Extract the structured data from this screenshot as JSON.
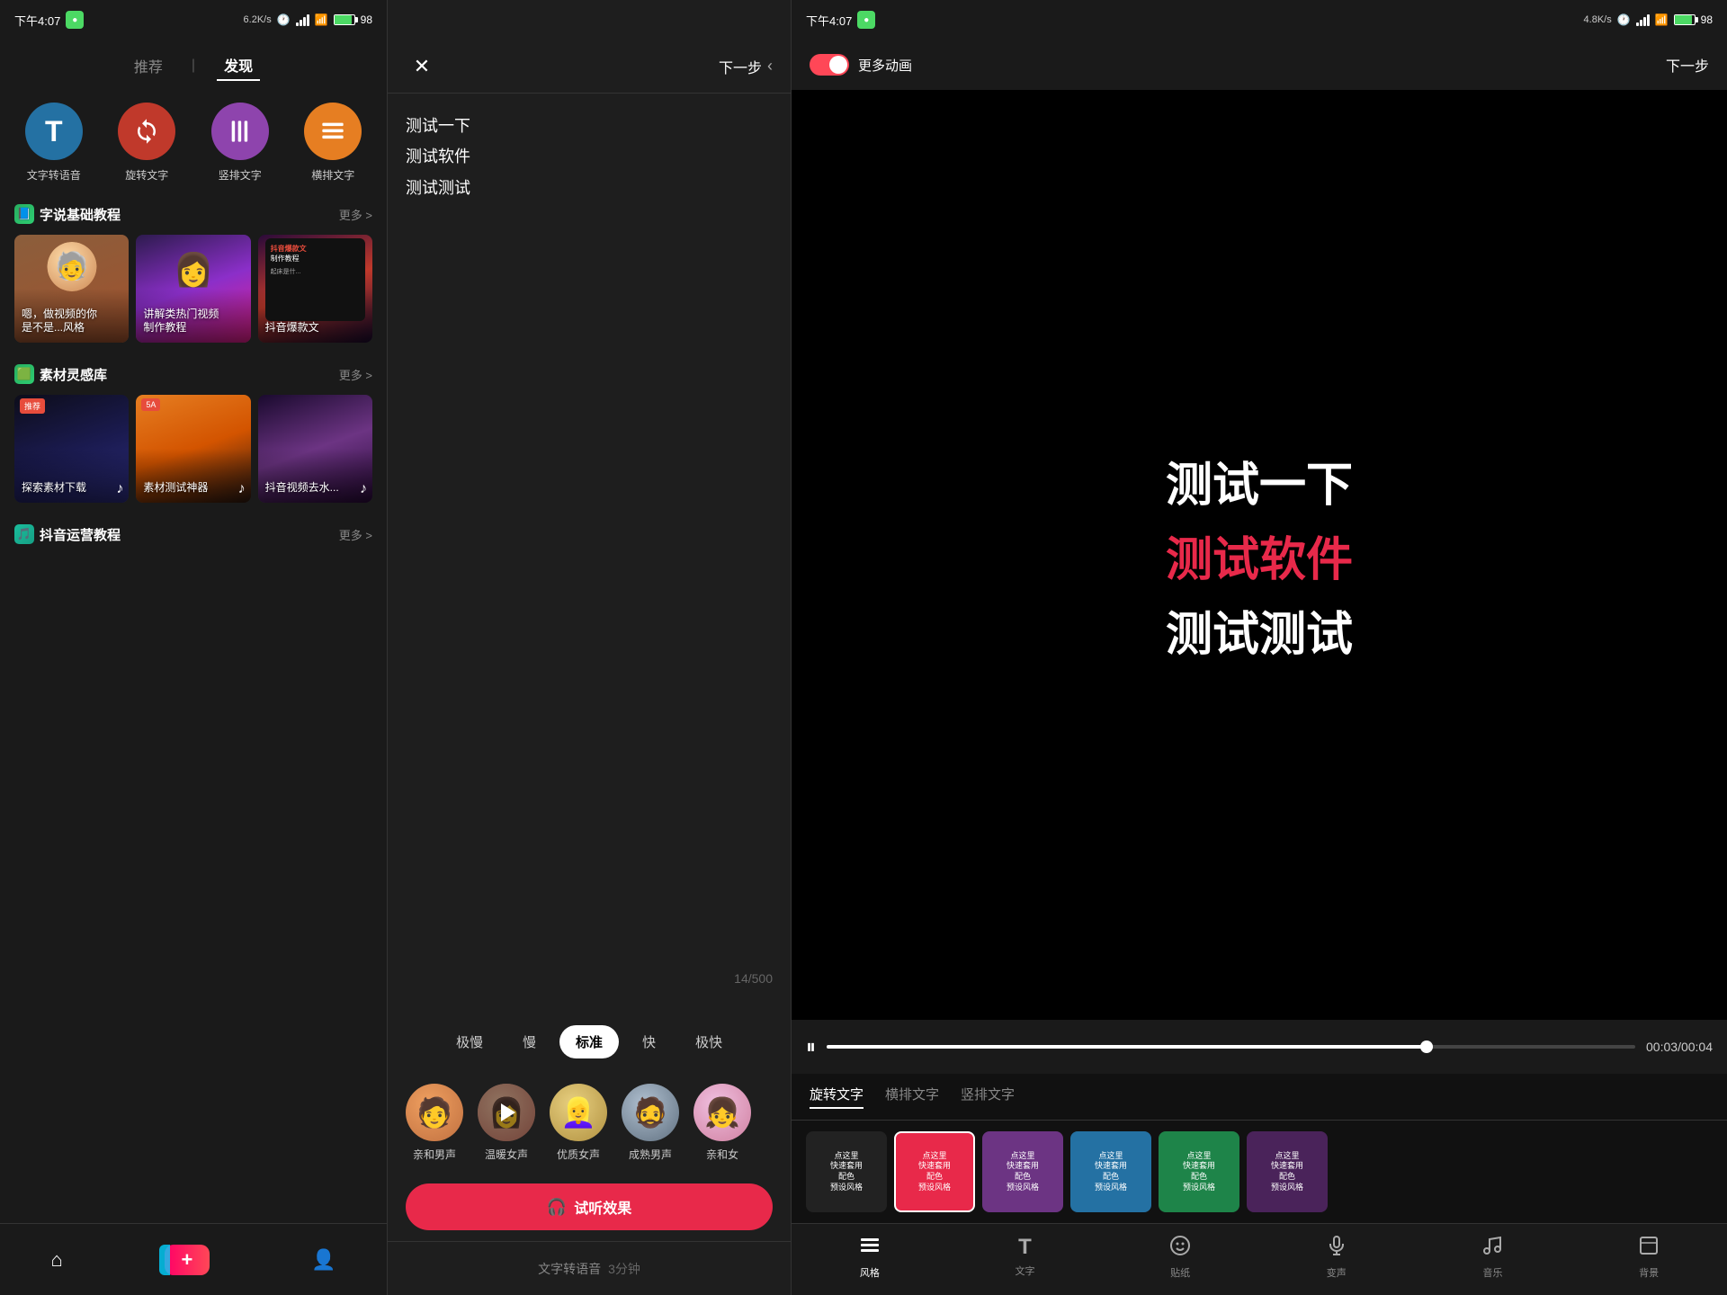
{
  "panel_left": {
    "status_bar": {
      "time": "下午4:07",
      "speed": "6.2K/s",
      "battery_pct": "98"
    },
    "nav": {
      "tab1": "推荐",
      "divider": "|",
      "tab2": "发现",
      "active": "发现"
    },
    "features": [
      {
        "id": "speech",
        "label": "文字转语音",
        "color": "#3498db",
        "icon": "T"
      },
      {
        "id": "rotate",
        "label": "旋转文字",
        "color": "#e74c3c",
        "icon": "↻"
      },
      {
        "id": "vertical",
        "label": "竖排文字",
        "color": "#9b59b6",
        "icon": "≡"
      },
      {
        "id": "horizontal",
        "label": "横排文字",
        "color": "#e67e22",
        "icon": "☰"
      }
    ],
    "section1": {
      "icon": "🟦",
      "title": "字说基础教程",
      "more": "更多 >"
    },
    "tutorial_cards": [
      {
        "label": "嗯，做视频的你\n是不是...风格",
        "bg": "cartoon"
      },
      {
        "label": "讲解类热门视频\n制作教程",
        "bg": "purple"
      },
      {
        "label": "抖音爆款文\n制作教程\n起床是什...",
        "bg": "dark-red"
      }
    ],
    "section2": {
      "icon": "🟩",
      "title": "素材灵感库",
      "more": "更多 >"
    },
    "material_cards": [
      {
        "label": "探索素材下载",
        "tag": "推荐",
        "bg": "city-night"
      },
      {
        "label": "5A 素材测试神器",
        "bg": "orange-city"
      },
      {
        "label": "抖音视频去水...",
        "bg": "dark-purple"
      }
    ],
    "section3": {
      "icon": "🎵",
      "title": "抖音运营教程",
      "more": "更多 >"
    },
    "bottom_nav": [
      {
        "id": "home",
        "icon": "⌂",
        "active": true
      },
      {
        "id": "plus",
        "icon": "+",
        "isPlus": true
      },
      {
        "id": "user",
        "icon": "👤",
        "active": false
      }
    ]
  },
  "panel_middle": {
    "status_bar": {
      "time": ""
    },
    "header": {
      "close_label": "✕",
      "next_label": "下一步",
      "next_arrow": "‹"
    },
    "editor": {
      "lines": [
        "测试一下",
        "测试软件",
        "测试测试"
      ],
      "char_count": "14/500"
    },
    "speed_options": [
      "极慢",
      "慢",
      "标准",
      "快",
      "极快"
    ],
    "active_speed": "标准",
    "voices": [
      {
        "name": "亲和男声",
        "color1": "#c0392b",
        "color2": "#922b21"
      },
      {
        "name": "温暖女声",
        "color1": "#8e44ad",
        "color2": "#6c3483",
        "is_playing": true
      },
      {
        "name": "优质女声",
        "color1": "#d4ac0d",
        "color2": "#9a7d0a"
      },
      {
        "name": "成熟男声",
        "color1": "#2471a3",
        "color2": "#1a5276"
      },
      {
        "name": "亲和女",
        "color1": "#e91e8c",
        "color2": "#ad1457"
      }
    ],
    "preview_btn": "试听效果",
    "bottom_bar": {
      "label1": "文字转语音",
      "label2": "3分钟"
    }
  },
  "panel_right": {
    "status_bar": {
      "time": "下午4:07",
      "speed": "4.8K/s",
      "battery_pct": "98"
    },
    "header": {
      "toggle_label": "更多动画",
      "next_label": "下一步"
    },
    "preview": {
      "line1": "测试一下",
      "line2": "测试软件",
      "line3": "测试测试"
    },
    "timeline": {
      "time_current": "00:03",
      "time_total": "00:04",
      "progress_pct": 75
    },
    "style_tabs": [
      "旋转文字",
      "横排文字",
      "竖排文字"
    ],
    "active_style_tab": "旋转文字",
    "presets": [
      {
        "id": "p1",
        "text": "点这里\n快速套用\n配色\n预设风格",
        "bg": "pc-black",
        "selected": false
      },
      {
        "id": "p2",
        "text": "点这里\n快速套用\n配色\n预设风格",
        "bg": "pc-red",
        "selected": true
      },
      {
        "id": "p3",
        "text": "点这里\n快速套用\n配色\n预设风格",
        "bg": "pc-purple",
        "selected": false
      },
      {
        "id": "p4",
        "text": "点这里\n快速套用\n配色\n预设风格",
        "bg": "pc-blue",
        "selected": false
      },
      {
        "id": "p5",
        "text": "点这里\n快速套用\n配色\n预设风格",
        "bg": "pc-green",
        "selected": false
      },
      {
        "id": "p6",
        "text": "点这里\n快速套用\n配色\n预设风格",
        "bg": "pc-dark-purple",
        "selected": false
      }
    ],
    "toolbar": [
      {
        "id": "style",
        "icon": "≡",
        "label": "风格",
        "active": true
      },
      {
        "id": "text",
        "icon": "T",
        "label": "文字",
        "active": false
      },
      {
        "id": "sticker",
        "icon": "◉",
        "label": "贴纸",
        "active": false
      },
      {
        "id": "voice",
        "icon": "🎤",
        "label": "变声",
        "active": false
      },
      {
        "id": "music",
        "icon": "♪",
        "label": "音乐",
        "active": false
      },
      {
        "id": "bg",
        "icon": "□",
        "label": "背景",
        "active": false
      }
    ]
  }
}
